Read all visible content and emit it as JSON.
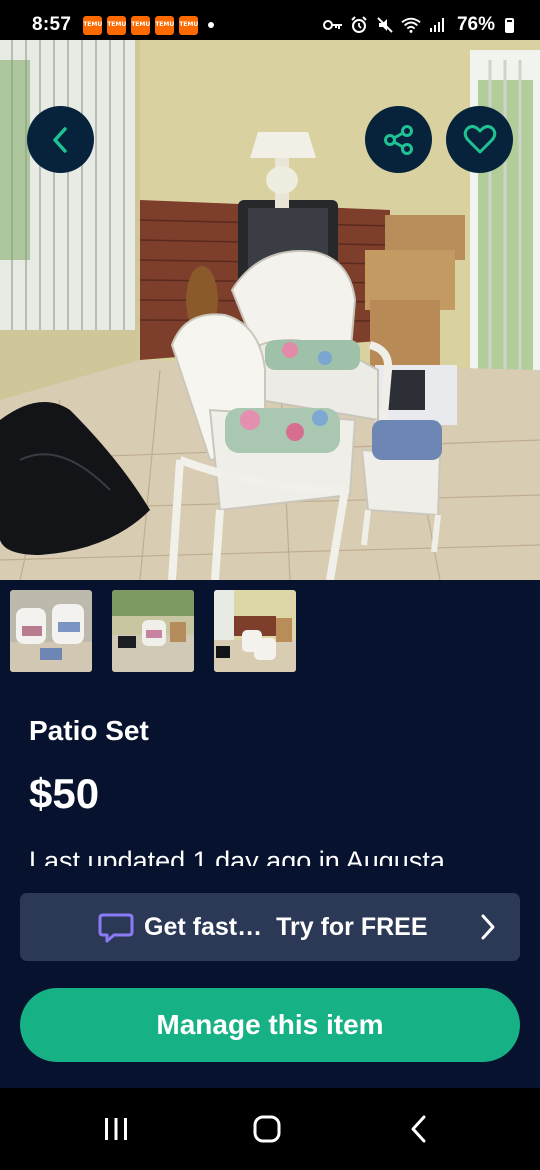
{
  "status_bar": {
    "time": "8:57",
    "notification_icons": [
      {
        "icon": "temu-icon",
        "label": "TEMU"
      },
      {
        "icon": "temu-icon",
        "label": "TEMU"
      },
      {
        "icon": "temu-icon",
        "label": "TEMU"
      },
      {
        "icon": "temu-icon",
        "label": "TEMU"
      },
      {
        "icon": "temu-icon",
        "label": "TEMU"
      }
    ],
    "system_icons": [
      "key-icon",
      "alarm-icon",
      "mute-icon",
      "wifi-icon",
      "signal-icon"
    ],
    "battery": "76%",
    "battery_level": 0.76
  },
  "header_actions": {
    "back_icon": "chevron-left-icon",
    "share_icon": "share-icon",
    "favorite_icon": "heart-icon"
  },
  "photos": {
    "count": 3,
    "selected_index": 0
  },
  "listing": {
    "title": "Patio Set",
    "price": "$50",
    "updated": "Last updated 1 day ago in Augusta"
  },
  "promo": {
    "icon": "chat-bubble-icon",
    "text": "Get fast…",
    "cta": "Try for FREE"
  },
  "manage_button": {
    "label": "Manage this item"
  },
  "colors": {
    "background": "#06122e",
    "accent": "#16b184",
    "promo_bg": "#2b3856",
    "icon_circle": "#06233b",
    "promo_icon": "#8b7cf6"
  }
}
